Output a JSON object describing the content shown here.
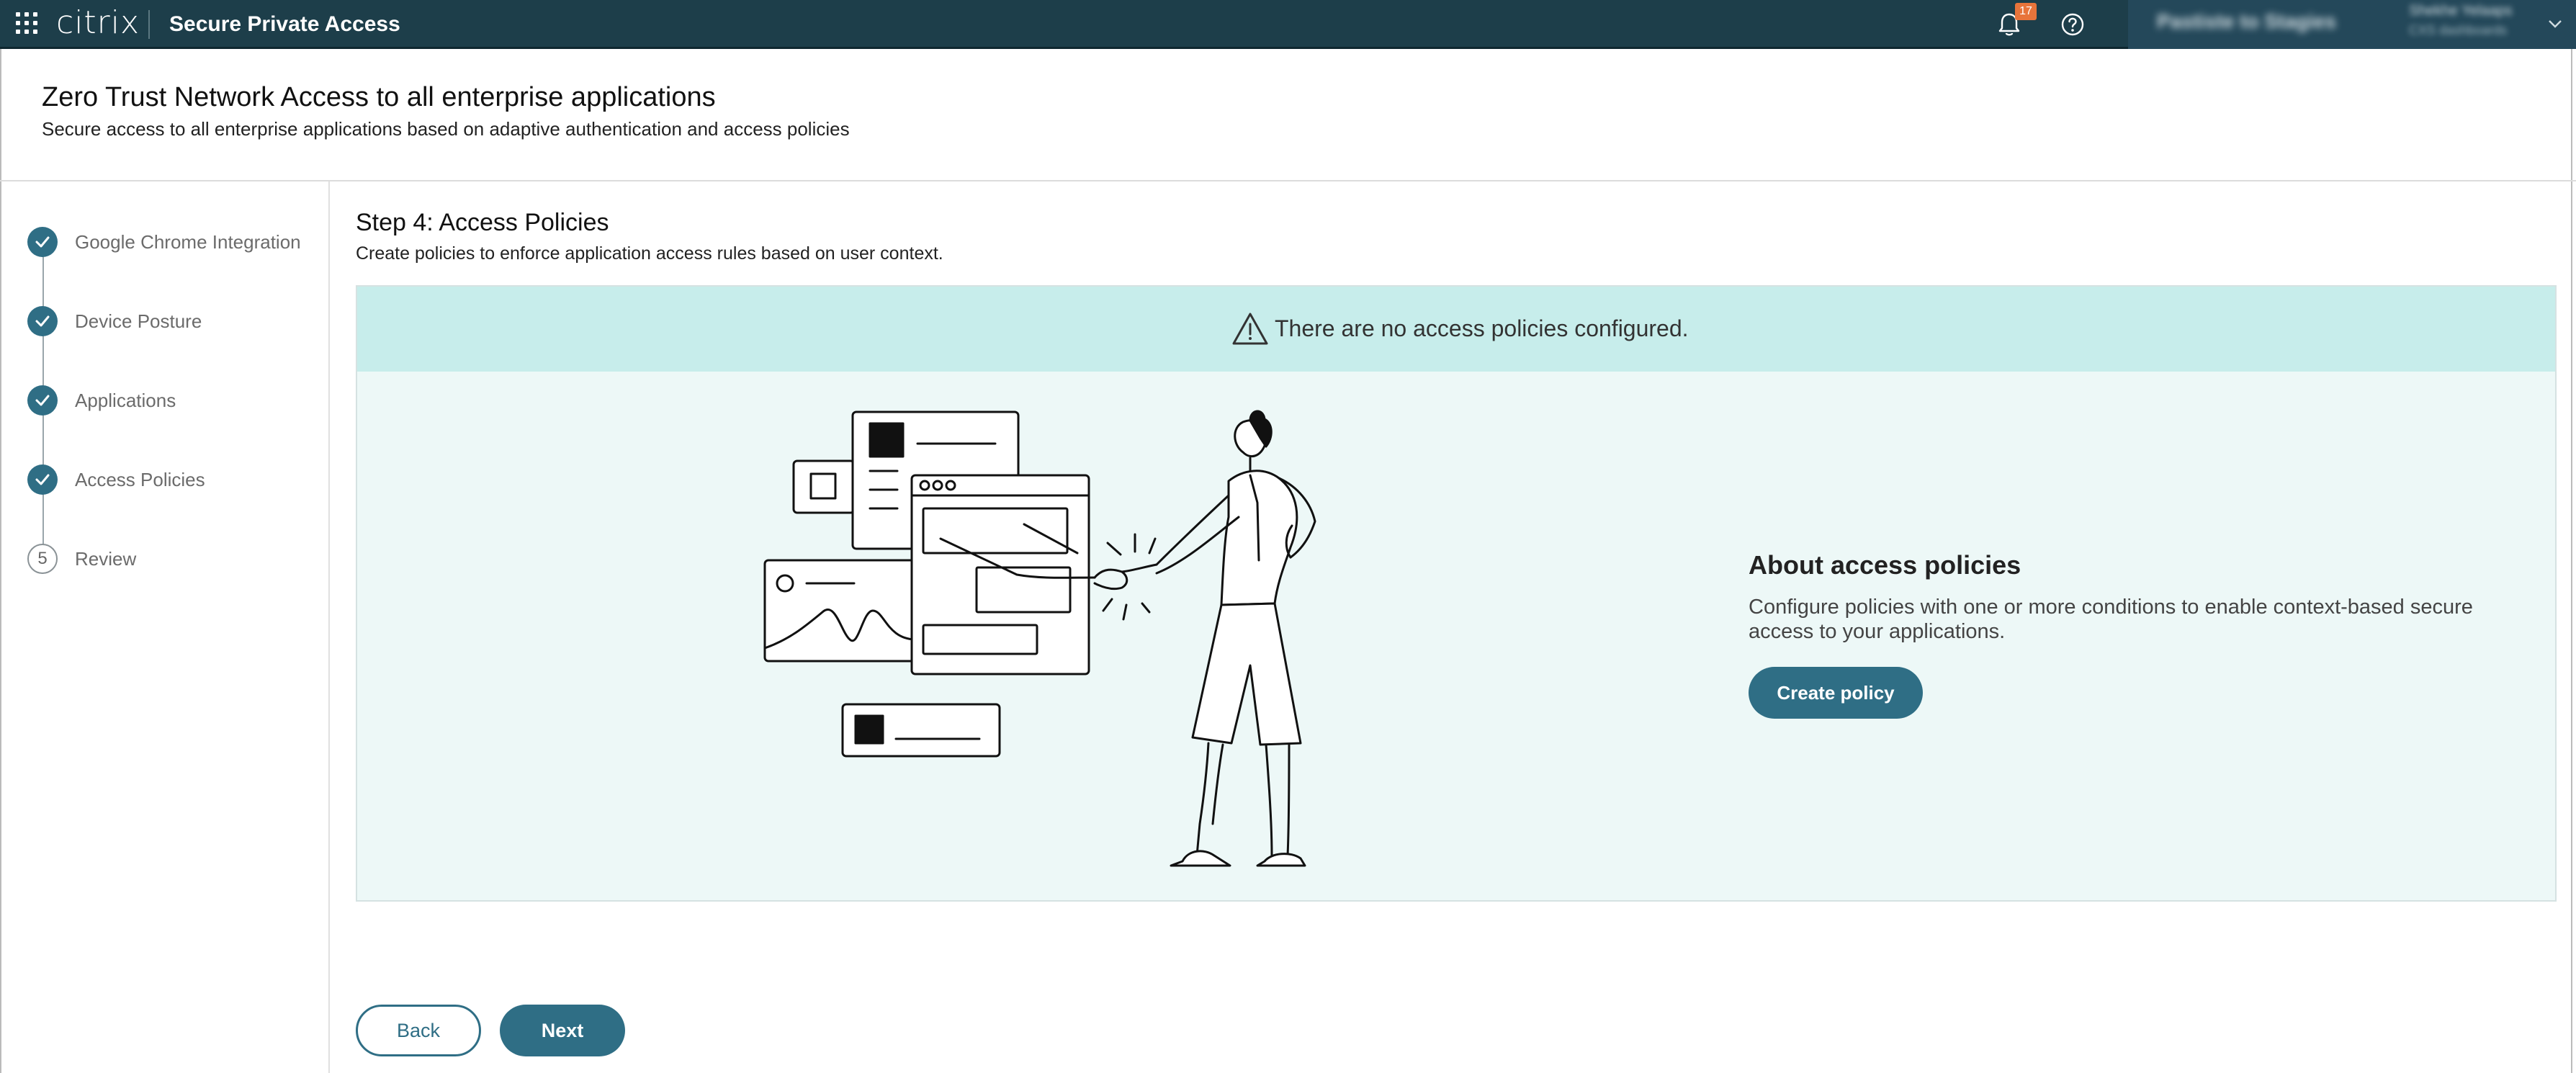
{
  "topbar": {
    "brand": "citrix",
    "product": "Secure Private Access",
    "notification_count": "17",
    "user_org": "Pastiste to Stagies",
    "user_name": "Shekhe Yelaaps",
    "user_sub": "CXS dashboards"
  },
  "header": {
    "title": "Zero Trust Network Access to all enterprise applications",
    "subtitle": "Secure access to all enterprise applications based on adaptive authentication and access policies"
  },
  "steps": [
    {
      "label": "Google Chrome Integration",
      "status": "done"
    },
    {
      "label": "Device Posture",
      "status": "done"
    },
    {
      "label": "Applications",
      "status": "done"
    },
    {
      "label": "Access Policies",
      "status": "done"
    },
    {
      "label": "Review",
      "status": "todo",
      "number": "5"
    }
  ],
  "content": {
    "step_title": "Step 4: Access Policies",
    "step_desc": "Create policies to enforce application access rules based on user context.",
    "warning": "There are no access policies configured.",
    "about_title": "About access policies",
    "about_desc": "Configure policies with one or more conditions to enable context-based secure access to your applications.",
    "create_label": "Create policy"
  },
  "footer": {
    "back_label": "Back",
    "next_label": "Next"
  },
  "colors": {
    "topbar": "#1d3e4a",
    "accent": "#2f6e85",
    "banner": "#c7edeb",
    "panel": "#edf8f7"
  }
}
